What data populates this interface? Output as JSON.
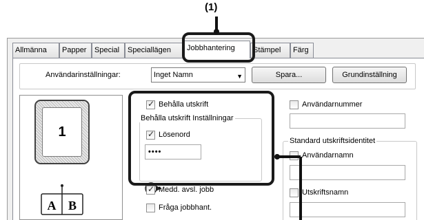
{
  "callout": {
    "label": "(1)"
  },
  "tabs": [
    {
      "label": "Allmänna"
    },
    {
      "label": "Papper"
    },
    {
      "label": "Special"
    },
    {
      "label": "Speciallägen"
    },
    {
      "label": "Jobbhantering"
    },
    {
      "label": "Stämpel"
    },
    {
      "label": "Färg"
    }
  ],
  "active_tab": "Jobbhantering",
  "user_settings": {
    "label": "Användarinställningar:",
    "selected": "Inget Namn",
    "save_button": "Spara...",
    "default_button": "Grundinställning"
  },
  "preview": {
    "page_number": "1",
    "book_letters": [
      "A",
      "B"
    ]
  },
  "retention": {
    "keep_printout_label": "Behålla utskrift",
    "keep_printout_checked": true,
    "group_title": "Behålla utskrift Inställningar",
    "password_label": "Lösenord",
    "password_checked": true,
    "password_value": "••••"
  },
  "notify": {
    "job_end_label": "Medd. avsl. jobb",
    "job_end_checked": true,
    "ask_job_label": "Fråga jobbhant.",
    "ask_job_checked": false
  },
  "user_number": {
    "label": "Användarnummer",
    "checked": false,
    "value": ""
  },
  "print_identity": {
    "group_title": "Standard utskriftsidentitet",
    "username_label": "Användarnamn",
    "username_checked": false,
    "username_value": "",
    "jobname_label": "Utskriftsnamn",
    "jobname_checked": false,
    "jobname_value": ""
  }
}
